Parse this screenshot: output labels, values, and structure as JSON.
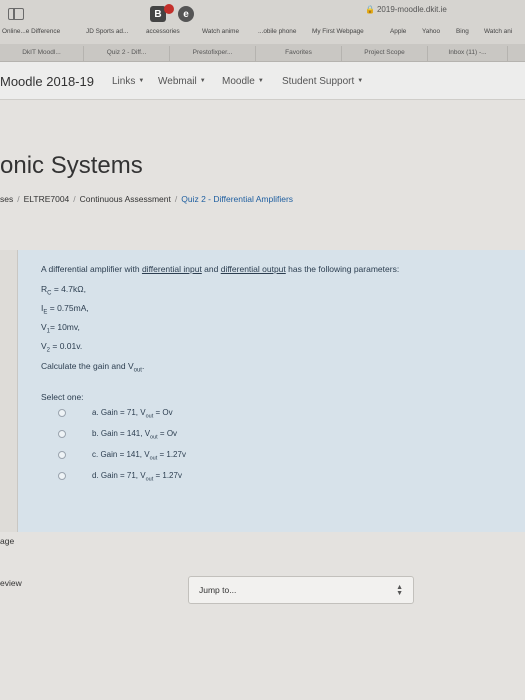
{
  "browser": {
    "url": "2019-moodle.dkit.ie",
    "bookmarks": [
      "Online...e Difference",
      "JD Sports ad...",
      "accessories",
      "Watch anime",
      "...obile phone",
      "My First Webpage",
      "Apple",
      "Yahoo",
      "Bing",
      "Watch ani"
    ],
    "tabs": [
      "DkIT Moodl...",
      "Quiz 2 - Diff...",
      "Prestofixper...",
      "Favorites",
      "Project Scope",
      "Inbox (11) -..."
    ]
  },
  "navbar": {
    "brand": "Moodle 2018-19",
    "items": [
      "Links",
      "Webmail",
      "Moodle",
      "Student Support"
    ]
  },
  "page": {
    "course_title": "onic Systems",
    "breadcrumb": [
      "ses",
      "ELTRE7004",
      "Continuous Assessment",
      "Quiz 2 - Differential Amplifiers"
    ]
  },
  "question": {
    "intro_a": "A differential amplifier with ",
    "intro_link1": "differential input",
    "intro_b": " and ",
    "intro_link2": "differential output",
    "intro_c": " has the following parameters:",
    "params": [
      {
        "sym": "R",
        "sub": "C",
        "val": " = 4.7kΩ,"
      },
      {
        "sym": "I",
        "sub": "E",
        "val": " = 0.75mA,"
      },
      {
        "sym": "V",
        "sub": "1",
        "val": "= 10mv,"
      },
      {
        "sym": "V",
        "sub": "2",
        "val": " = 0.01v."
      }
    ],
    "calc_a": "Calculate the gain and V",
    "calc_sub": "out",
    "calc_b": ".",
    "select_label": "Select one:",
    "options": [
      {
        "pre": "a. Gain = 71, V",
        "sub": "out",
        "post": " = Ov"
      },
      {
        "pre": "b. Gain = 141, V",
        "sub": "out",
        "post": " = Ov"
      },
      {
        "pre": "c. Gain = 141, V",
        "sub": "out",
        "post": " = 1.27v"
      },
      {
        "pre": "d. Gain = 71, V",
        "sub": "out",
        "post": " = 1.27v"
      }
    ]
  },
  "footer": {
    "page_label": "age",
    "review_label": "eview",
    "jump_label": "Jump to..."
  }
}
